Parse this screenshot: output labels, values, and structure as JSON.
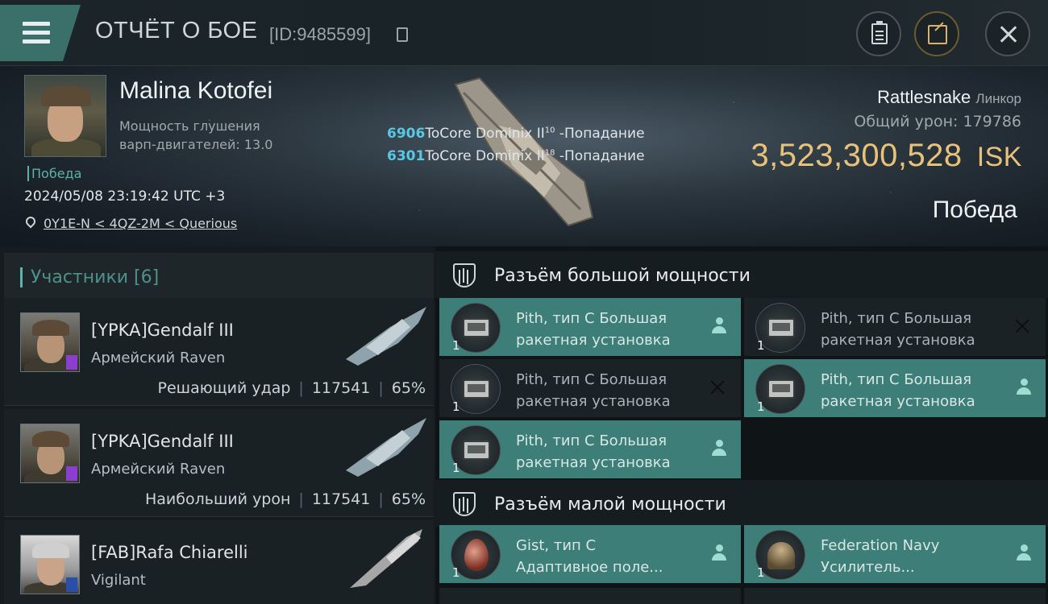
{
  "header": {
    "title": "ОТЧЁТ О БОЕ",
    "battle_id": "[ID:9485599]"
  },
  "victim": {
    "name": "Malina Kotofei",
    "warp_line1": "Мощность глушения",
    "warp_line2": "варп-двигателей: 13.0",
    "status_small": "Победа",
    "datetime": "2024/05/08 23:19:42 UTC +3",
    "location": "0Y1E-N < 4QZ-2M < Querious"
  },
  "hits": [
    {
      "num": "6906",
      "text": "ToCore Dominix II",
      "sup": "10",
      "suffix": " -Попадание"
    },
    {
      "num": "6301",
      "text": "ToCore Dominix II",
      "sup": "18",
      "suffix": " -Попадание"
    }
  ],
  "summary": {
    "ship_name": "Rattlesnake",
    "ship_class": "Линкор",
    "total_damage_label": "Общий урон:",
    "total_damage": "179786",
    "isk_value": "3,523,300,528",
    "isk_unit": "ISK",
    "result": "Победа"
  },
  "participants": {
    "header": "Участники [6]",
    "rows": [
      {
        "name": "[YPKA]Gendalf III",
        "ship": "Армейский Raven",
        "role": "Решающий удар",
        "damage": "117541",
        "percent": "65%"
      },
      {
        "name": "[YPKA]Gendalf III",
        "ship": "Армейский Raven",
        "role": "Наибольший урон",
        "damage": "117541",
        "percent": "65%"
      },
      {
        "name": "[FAB]Rafa Chiarelli",
        "ship": "Vigilant",
        "role": "",
        "damage": "",
        "percent": ""
      }
    ]
  },
  "high_slots": {
    "title": "Разъём большой мощности",
    "modules": [
      {
        "line1": "Pith, тип C Большая",
        "line2": "ракетная установка",
        "qty": "1",
        "state": "dropped"
      },
      {
        "line1": "Pith, тип C Большая",
        "line2": "ракетная установка",
        "qty": "1",
        "state": "destroyed"
      },
      {
        "line1": "Pith, тип C Большая",
        "line2": "ракетная установка",
        "qty": "1",
        "state": "destroyed"
      },
      {
        "line1": "Pith, тип C Большая",
        "line2": "ракетная установка",
        "qty": "1",
        "state": "dropped"
      },
      {
        "line1": "Pith, тип C Большая",
        "line2": "ракетная установка",
        "qty": "1",
        "state": "dropped"
      }
    ]
  },
  "low_slots": {
    "title": "Разъём малой мощности",
    "modules": [
      {
        "line1": "Gist, тип C",
        "line2": "Адаптивное поле...",
        "qty": "1",
        "state": "dropped"
      },
      {
        "line1": "Federation Navy",
        "line2": "Усилитель...",
        "qty": "1",
        "state": "dropped"
      }
    ]
  },
  "colors": {
    "accent_teal": "#3d7f78",
    "isk_gold": "#e9c27a",
    "hit_blue": "#58c8e4"
  }
}
